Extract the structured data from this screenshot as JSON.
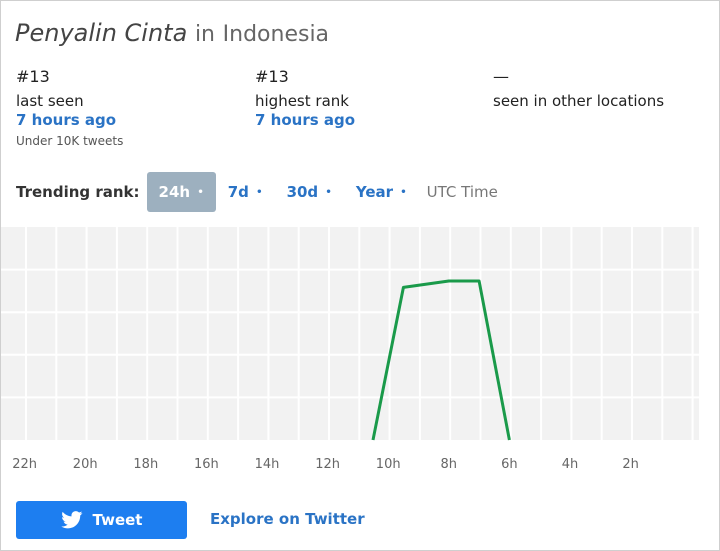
{
  "header": {
    "topic": "Penyalin Cinta",
    "connector": "in",
    "location": "Indonesia"
  },
  "stats": [
    {
      "value": "#13",
      "label": "last seen",
      "link": "7 hours ago",
      "note": "Under 10K tweets"
    },
    {
      "value": "#13",
      "label": "highest rank",
      "link": "7 hours ago"
    },
    {
      "value": "—",
      "label": "seen in other locations"
    }
  ],
  "trending": {
    "label": "Trending rank:",
    "tabs": [
      "24h",
      "7d",
      "30d",
      "Year"
    ],
    "active_tab": "24h",
    "tab_dot": "•",
    "timezone": "UTC Time"
  },
  "chart_data": {
    "type": "line",
    "x_tick_labels": [
      "22h",
      "20h",
      "18h",
      "16h",
      "14h",
      "12h",
      "10h",
      "8h",
      "6h",
      "4h",
      "2h"
    ],
    "series": [
      {
        "line_color": "#1a9a4a",
        "points": [
          {
            "x_hours_ago": 10.5,
            "y_rank": 30
          },
          {
            "x_hours_ago": 9.5,
            "y_rank": 14.3
          },
          {
            "x_hours_ago": 8.0,
            "y_rank": 13
          },
          {
            "x_hours_ago": 7.0,
            "y_rank": 13
          },
          {
            "x_hours_ago": 6.0,
            "y_rank": 30
          }
        ]
      }
    ],
    "y_axis_rank_bottom": 30,
    "y_axis_rank_top": 6,
    "grid": true,
    "grid_background": "#f2f2f2"
  },
  "footer": {
    "tweet_label": "Tweet",
    "explore_label": "Explore on Twitter"
  },
  "colors": {
    "accent": "#2a73c5",
    "tweet_button": "#1d7ef0",
    "active_tab": "#9db0bf"
  }
}
